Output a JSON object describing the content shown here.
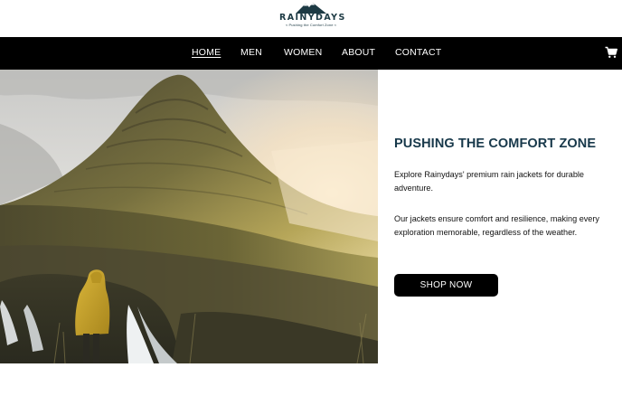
{
  "brand": {
    "name": "RAINYDAYS",
    "tagline": "≈ Pushing the Comfort Zone ≈"
  },
  "nav": {
    "items": [
      {
        "label": "HOME",
        "active": true
      },
      {
        "label": "MEN",
        "active": false
      },
      {
        "label": "WOMEN",
        "active": false
      },
      {
        "label": "ABOUT",
        "active": false
      },
      {
        "label": "CONTACT",
        "active": false
      }
    ],
    "cart_icon": "cart-icon"
  },
  "hero": {
    "image_subject": "hiker-in-yellow-jacket-facing-mountain",
    "title": "PUSHING THE COMFORT ZONE",
    "paragraph_1": "Explore Rainydays' premium rain jackets for durable adventure.",
    "paragraph_2": "Our jackets ensure comfort and resilience, making every exploration memorable, regardless of the weather.",
    "cta_label": "SHOP NOW"
  },
  "colors": {
    "nav_background": "#000000",
    "title_color": "#17384a",
    "button_background": "#000000",
    "jacket_yellow": "#c9a52a"
  }
}
